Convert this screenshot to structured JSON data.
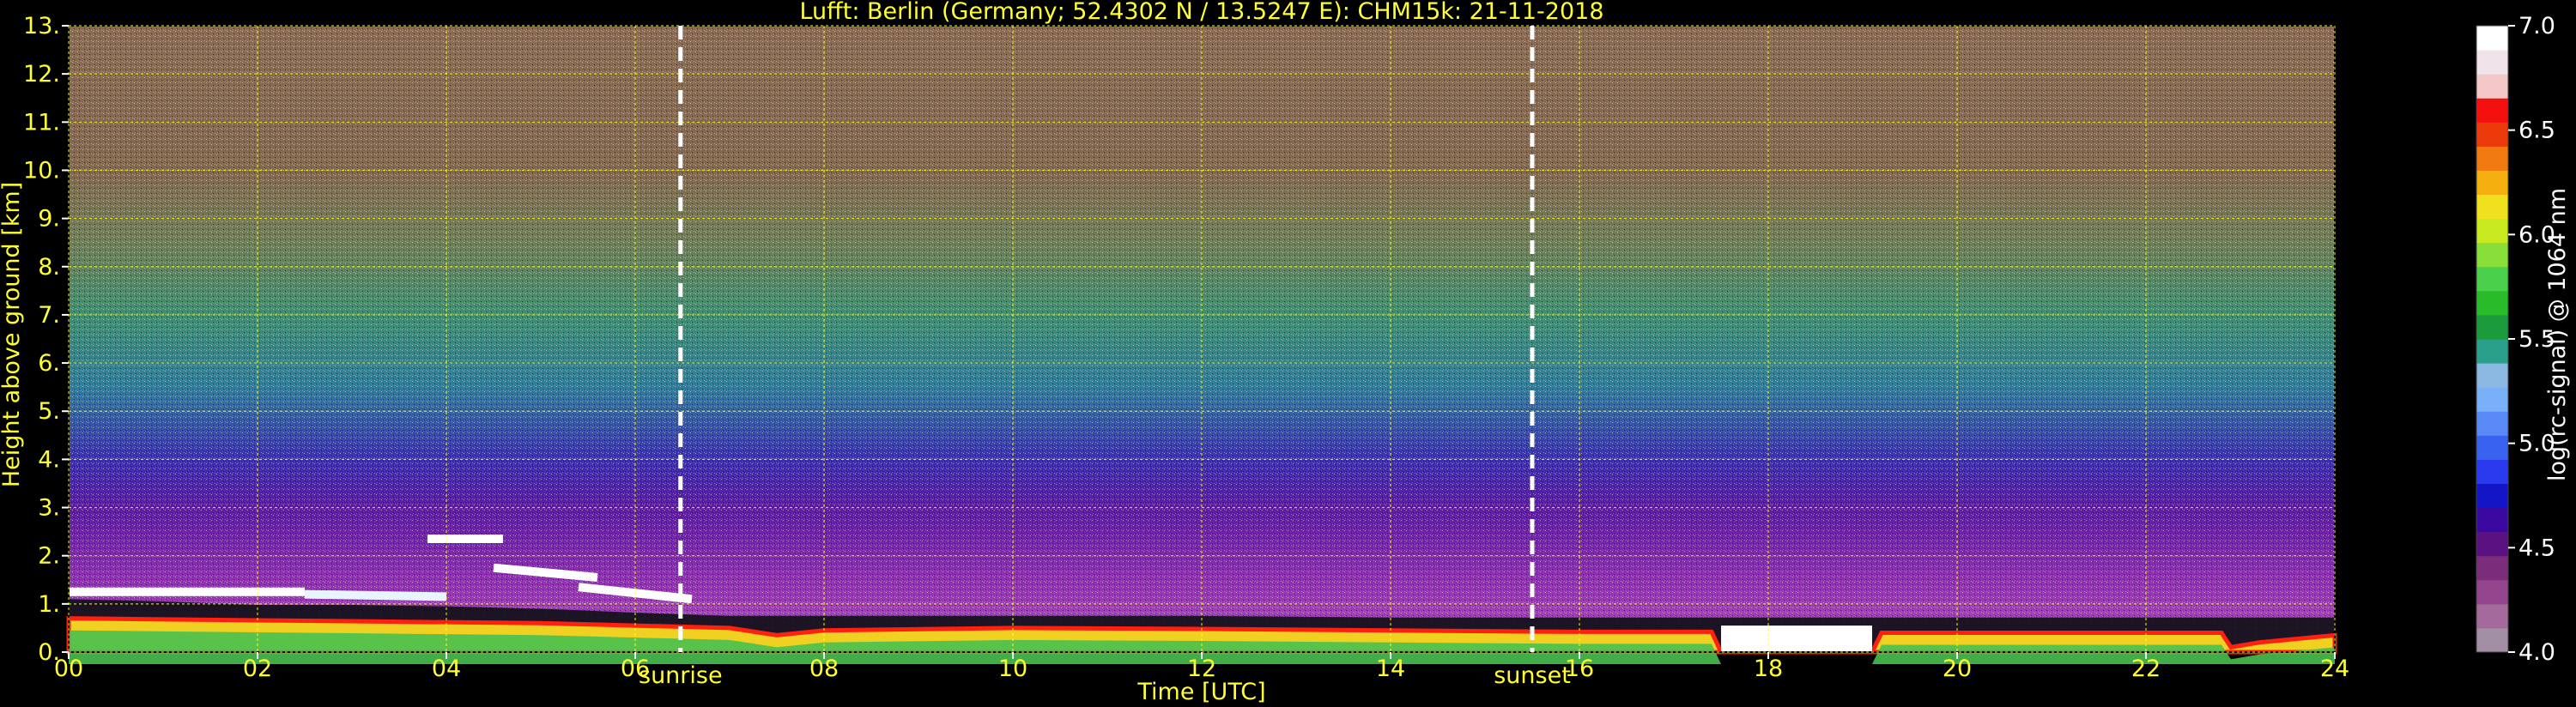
{
  "chart_data": {
    "type": "heatmap",
    "title": "Lufft: Berlin (Germany; 52.4302 N / 13.5247 E):    CHM15k: 21-11-2018",
    "xlabel": "Time [UTC]",
    "ylabel": "Height above ground [km]",
    "xlim": [
      0,
      24
    ],
    "ylim": [
      0,
      13
    ],
    "x_ticks": [
      "00",
      "02",
      "04",
      "06",
      "08",
      "10",
      "12",
      "14",
      "16",
      "18",
      "20",
      "22",
      "24"
    ],
    "y_ticks": [
      "0.",
      "1.",
      "2.",
      "3.",
      "4.",
      "5.",
      "6.",
      "7.",
      "8.",
      "9.",
      "10.",
      "11.",
      "12.",
      "13."
    ],
    "grid": true,
    "vertical_markers": [
      {
        "label": "sunrise",
        "x": 6.48
      },
      {
        "label": "sunset",
        "x": 15.5
      }
    ],
    "colorbar": {
      "label": "log(rc-signal) @ 1064 nm",
      "range": [
        4.0,
        7.0
      ],
      "ticks": [
        "4.0",
        "4.5",
        "5.0",
        "5.5",
        "6.0",
        "6.5",
        "7.0"
      ],
      "colors": [
        "#a38fa3",
        "#a36a9b",
        "#94448c",
        "#7a2d7a",
        "#5a1282",
        "#3a0aa0",
        "#1515c8",
        "#2a3aee",
        "#3a62f0",
        "#5a8af5",
        "#7ab0f8",
        "#8ab8e0",
        "#2aa08a",
        "#1a9a3a",
        "#2abb2a",
        "#4ad04a",
        "#8ade3a",
        "#c8e820",
        "#f0e020",
        "#f5b010",
        "#f07a10",
        "#ea3a0a",
        "#f51010",
        "#f5c8c8",
        "#f0e4ea",
        "#ffffff"
      ]
    },
    "layers": {
      "background_gradient": [
        {
          "h": 0.0,
          "color": "#b14fb8"
        },
        {
          "h": 1.5,
          "color": "#8e2fb0"
        },
        {
          "h": 3.0,
          "color": "#5a1aa0"
        },
        {
          "h": 4.0,
          "color": "#3a2eae"
        },
        {
          "h": 5.5,
          "color": "#2f7c9a"
        },
        {
          "h": 7.0,
          "color": "#3e8e70"
        },
        {
          "h": 8.5,
          "color": "#6e7e56"
        },
        {
          "h": 10.0,
          "color": "#83684e"
        },
        {
          "h": 13.0,
          "color": "#8a6a52"
        }
      ],
      "boundary_layer_top_km": [
        [
          0,
          1.1
        ],
        [
          1,
          1.05
        ],
        [
          2,
          0.98
        ],
        [
          3,
          0.98
        ],
        [
          4,
          0.95
        ],
        [
          5,
          0.9
        ],
        [
          6,
          0.82
        ],
        [
          7,
          0.75
        ],
        [
          8,
          0.75
        ],
        [
          10,
          0.75
        ],
        [
          12,
          0.75
        ],
        [
          14,
          0.72
        ],
        [
          16,
          0.72
        ],
        [
          18,
          0.72
        ],
        [
          20,
          0.72
        ],
        [
          22,
          0.72
        ],
        [
          24,
          0.72
        ]
      ],
      "aerosol_top_km": [
        [
          0,
          0.7
        ],
        [
          1,
          0.68
        ],
        [
          2,
          0.66
        ],
        [
          3,
          0.64
        ],
        [
          4,
          0.62
        ],
        [
          5,
          0.6
        ],
        [
          6,
          0.55
        ],
        [
          7,
          0.5
        ],
        [
          7.5,
          0.35
        ],
        [
          8,
          0.45
        ],
        [
          10,
          0.5
        ],
        [
          12,
          0.48
        ],
        [
          14,
          0.45
        ],
        [
          16,
          0.42
        ],
        [
          17.4,
          0.42
        ],
        [
          17.5,
          0.0
        ],
        [
          19.1,
          0.0
        ],
        [
          19.2,
          0.4
        ],
        [
          22.8,
          0.4
        ],
        [
          22.9,
          0.1
        ],
        [
          23.2,
          0.2
        ],
        [
          24,
          0.35
        ]
      ],
      "cloud_segments": [
        {
          "x": [
            0.0,
            2.5
          ],
          "h": [
            1.25,
            1.25
          ],
          "color": "#ffffff"
        },
        {
          "x": [
            2.5,
            4.0
          ],
          "h": [
            1.2,
            1.15
          ],
          "color": "#e8f4ff"
        },
        {
          "x": [
            3.8,
            4.6
          ],
          "h": [
            2.35,
            2.35
          ],
          "color": "#ffffff"
        },
        {
          "x": [
            4.5,
            5.6
          ],
          "h": [
            1.75,
            1.55
          ],
          "color": "#ffffff"
        },
        {
          "x": [
            5.4,
            6.6
          ],
          "h": [
            1.35,
            1.1
          ],
          "color": "#ffffff"
        },
        {
          "x": [
            17.5,
            19.1
          ],
          "h": [
            0.0,
            0.55
          ],
          "color": "#ffffff",
          "kind": "block"
        }
      ]
    }
  }
}
